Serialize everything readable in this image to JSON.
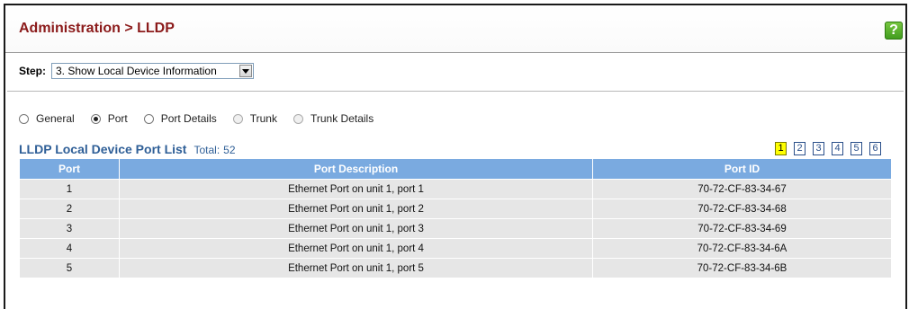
{
  "header": {
    "breadcrumb": "Administration > LLDP",
    "help_icon": "?"
  },
  "step": {
    "label": "Step:",
    "selected": "3. Show Local Device Information"
  },
  "radios": [
    {
      "label": "General",
      "checked": false,
      "enabled": true
    },
    {
      "label": "Port",
      "checked": true,
      "enabled": true
    },
    {
      "label": "Port Details",
      "checked": false,
      "enabled": true
    },
    {
      "label": "Trunk",
      "checked": false,
      "enabled": false
    },
    {
      "label": "Trunk Details",
      "checked": false,
      "enabled": false
    }
  ],
  "list": {
    "title": "LLDP Local Device Port List",
    "total_label": "Total:",
    "total": "52"
  },
  "pager": {
    "pages": [
      "1",
      "2",
      "3",
      "4",
      "5",
      "6"
    ],
    "current": "1"
  },
  "table": {
    "columns": [
      "Port",
      "Port Description",
      "Port ID"
    ],
    "rows": [
      [
        "1",
        "Ethernet Port on unit 1, port 1",
        "70-72-CF-83-34-67"
      ],
      [
        "2",
        "Ethernet Port on unit 1, port 2",
        "70-72-CF-83-34-68"
      ],
      [
        "3",
        "Ethernet Port on unit 1, port 3",
        "70-72-CF-83-34-69"
      ],
      [
        "4",
        "Ethernet Port on unit 1, port 4",
        "70-72-CF-83-34-6A"
      ],
      [
        "5",
        "Ethernet Port on unit 1, port 5",
        "70-72-CF-83-34-6B"
      ]
    ]
  }
}
